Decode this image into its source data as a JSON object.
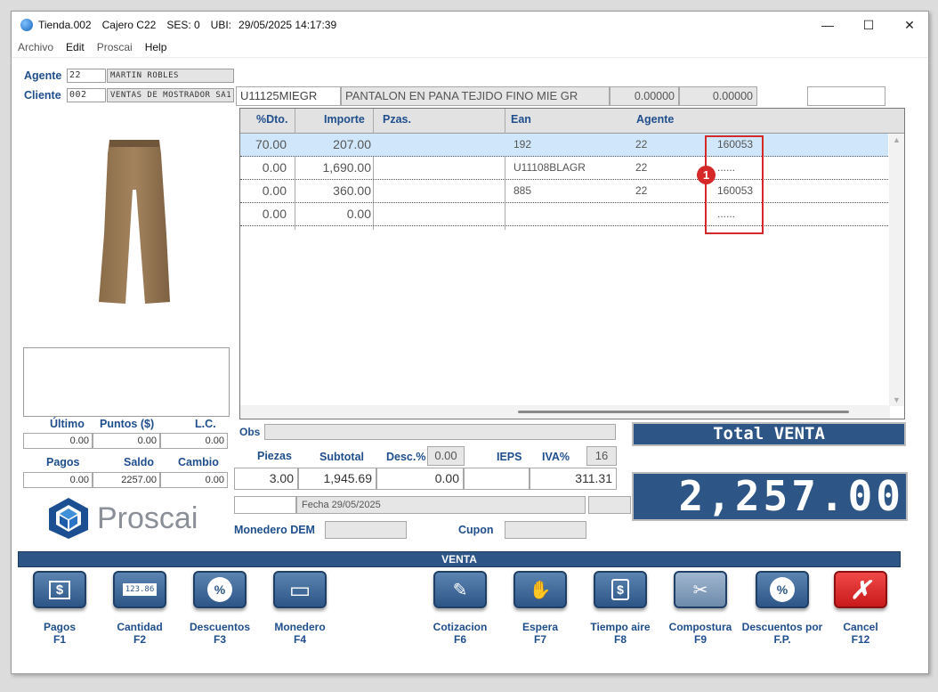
{
  "window": {
    "title": "Tienda.002",
    "cajero": "Cajero C22",
    "ses": "SES: 0",
    "ubi": "UBI:",
    "datetime": "29/05/2025 14:17:39",
    "min": "—",
    "max": "☐",
    "close": "✕"
  },
  "menu": [
    "Archivo",
    "Edit",
    "Proscai",
    "Help"
  ],
  "agente": {
    "label": "Agente",
    "code": "22",
    "name": "MARTIN ROBLES"
  },
  "cliente": {
    "label": "Cliente",
    "code": "002",
    "name": "VENTAS DE MOSTRADOR SA1"
  },
  "product": {
    "sku": "U11125MIEGR",
    "desc": "PANTALON EN PANA  TEJIDO FINO MIE GR",
    "val1": "0.00000",
    "val2": "0.00000",
    "extra": ""
  },
  "grid": {
    "headers": [
      "%Dto.",
      "Importe",
      "Pzas.",
      "Ean",
      "Agente"
    ],
    "rows": [
      {
        "dto": "70.00",
        "importe": "207.00",
        "pzas": "",
        "ean": "192",
        "agente": "22",
        "code": "160053"
      },
      {
        "dto": "0.00",
        "importe": "1,690.00",
        "pzas": "",
        "ean": "U11108BLAGR",
        "agente": "22",
        "code": "......"
      },
      {
        "dto": "0.00",
        "importe": "360.00",
        "pzas": "",
        "ean": "885",
        "agente": "22",
        "code": "160053"
      },
      {
        "dto": "0.00",
        "importe": "0.00",
        "pzas": "",
        "ean": "",
        "agente": "",
        "code": "......"
      }
    ],
    "callout_number": "1"
  },
  "left_stats": {
    "ultimo_label": "Último",
    "puntos_label": "Puntos ($)",
    "lc_label": "L.C.",
    "ultimo": "0.00",
    "puntos": "0.00",
    "lc": "0.00",
    "pagos_label": "Pagos",
    "saldo_label": "Saldo",
    "cambio_label": "Cambio",
    "pagos": "0.00",
    "saldo": "2257.00",
    "cambio": "0.00"
  },
  "summary": {
    "obs_label": "Obs",
    "piezas_label": "Piezas",
    "subtotal_label": "Subtotal",
    "desc_label": "Desc.%",
    "desc_pct": "0.00",
    "ieps_label": "IEPS",
    "iva_label": "IVA%",
    "iva_pct": "16",
    "piezas": "3.00",
    "subtotal": "1,945.69",
    "descuento": "0.00",
    "ieps": "",
    "iva": "311.31",
    "fecha": "Fecha 29/05/2025",
    "monedero_label": "Monedero DEM",
    "cupon_label": "Cupon"
  },
  "total": {
    "label": "Total VENTA",
    "value": "2,257.00"
  },
  "logo_text": "Proscai",
  "venta_bar": "VENTA",
  "fkeys": [
    {
      "label": "Pagos",
      "key": "F1",
      "icon": "$"
    },
    {
      "label": "Cantidad",
      "key": "F2",
      "icon": "123.86"
    },
    {
      "label": "Descuentos",
      "key": "F3",
      "icon": "%"
    },
    {
      "label": "Monedero",
      "key": "F4",
      "icon": "▭"
    },
    {
      "label": "Cotizacion",
      "key": "F6",
      "icon": "✎"
    },
    {
      "label": "Espera",
      "key": "F7",
      "icon": "✋"
    },
    {
      "label": "Tiempo aire",
      "key": "F8",
      "icon": "$"
    },
    {
      "label": "Compostura",
      "key": "F9",
      "icon": "✂"
    },
    {
      "label": "Descuentos por F.P.",
      "key": "",
      "icon": "%"
    },
    {
      "label": "Cancel",
      "key": "F12",
      "icon": "✗"
    }
  ],
  "colors": {
    "accent": "#2d5687",
    "label": "#1f4e8c",
    "callout": "#d62828"
  }
}
